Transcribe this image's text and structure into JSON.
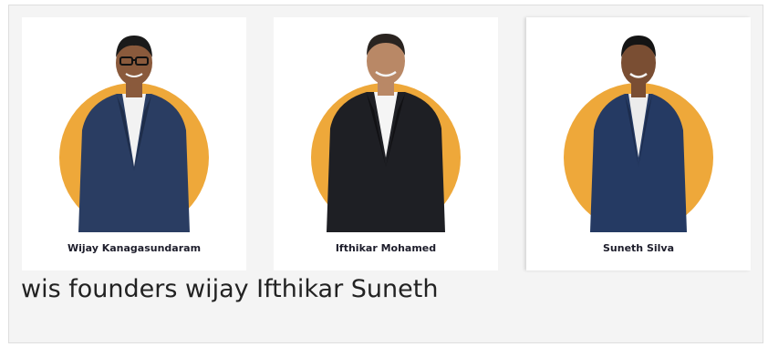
{
  "founders": [
    {
      "name": "Wijay Kanagasundaram",
      "suit_color": "#2a3d62",
      "accent_color": "#eea83a"
    },
    {
      "name": "Ifthikar Mohamed",
      "suit_color": "#1e1f24",
      "accent_color": "#eea83a"
    },
    {
      "name": "Suneth Silva",
      "suit_color": "#253a63",
      "accent_color": "#eea83a"
    }
  ],
  "caption": "wis founders wijay Ifthikar Suneth"
}
